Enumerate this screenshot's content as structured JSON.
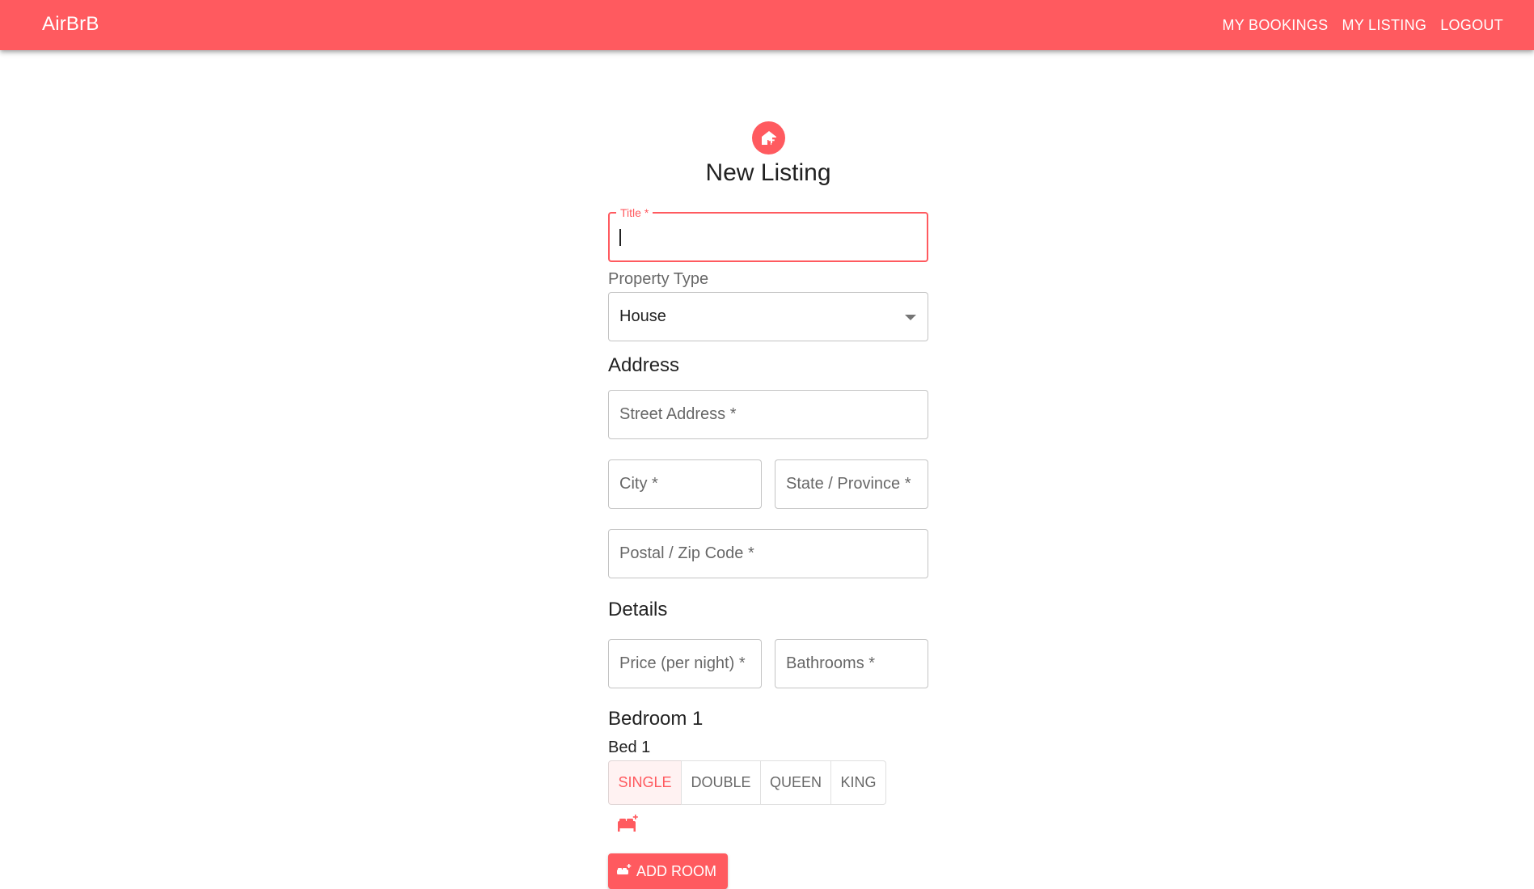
{
  "appbar": {
    "brand": "AirBrB",
    "nav": [
      "MY BOOKINGS",
      "MY LISTING",
      "LOGOUT"
    ],
    "color": "#ff5a5f"
  },
  "form": {
    "icon": "add-home-icon",
    "title": "New Listing",
    "title_field": {
      "label": "Title *",
      "value": ""
    },
    "property_type": {
      "label": "Property Type",
      "selected": "House"
    },
    "address": {
      "heading": "Address",
      "street_placeholder": "Street Address *",
      "city_placeholder": "City *",
      "state_placeholder": "State / Province *",
      "postal_placeholder": "Postal / Zip Code *"
    },
    "details": {
      "heading": "Details",
      "price_placeholder": "Price (per night) *",
      "bathrooms_placeholder": "Bathrooms *"
    },
    "bedroom": {
      "heading": "Bedroom 1",
      "bed_label": "Bed 1",
      "bed_types": [
        "SINGLE",
        "DOUBLE",
        "QUEEN",
        "KING"
      ],
      "selected_bed_type": "SINGLE",
      "add_bed_icon": "add-bed-icon"
    },
    "add_room_label": "ADD ROOM"
  }
}
